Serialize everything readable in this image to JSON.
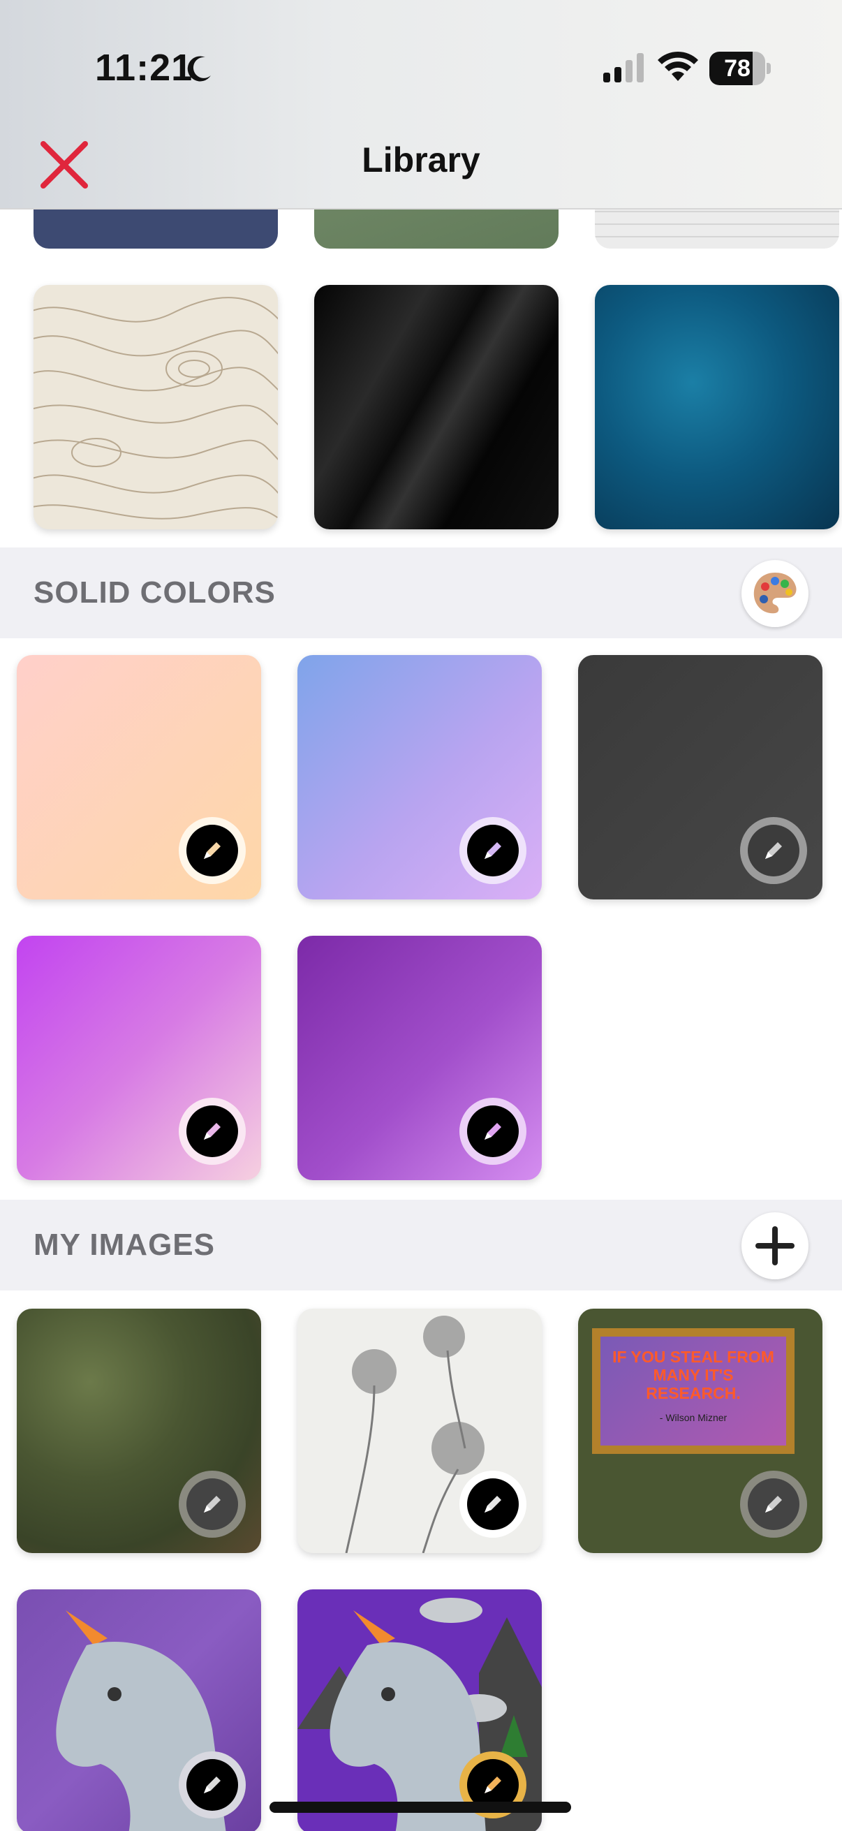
{
  "status_bar": {
    "time": "11:21",
    "battery": "78",
    "battery_level": 0.78
  },
  "nav": {
    "title": "Library"
  },
  "sections": {
    "solid_colors": {
      "title": "SOLID COLORS"
    },
    "my_images": {
      "title": "MY IMAGES"
    }
  },
  "icons": {
    "close": "close-x-icon",
    "palette": "palette-icon",
    "add": "plus-icon",
    "edit": "pencil-icon",
    "moon": "moon-icon"
  },
  "colors": {
    "close_red": "#e0263c",
    "section_bg": "#f0f0f4",
    "section_text": "#6e6e73"
  },
  "my_images": {
    "quote": {
      "text": "IF YOU STEAL FROM MANY IT'S RESEARCH.",
      "author": "- Wilson Mizner"
    }
  }
}
